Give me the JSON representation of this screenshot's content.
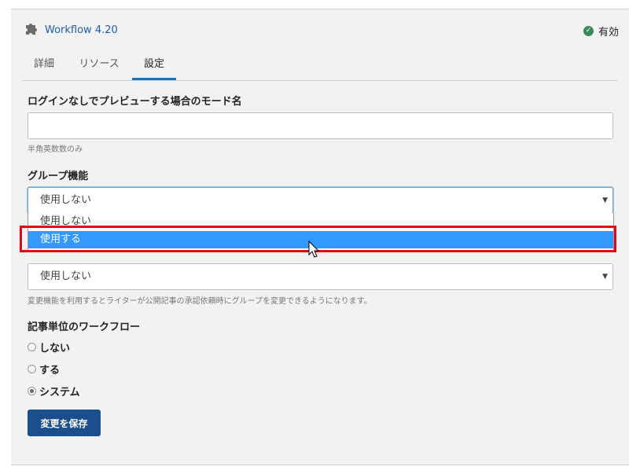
{
  "plugin": {
    "name": "Workflow 4.20",
    "icon": "puzzle-icon"
  },
  "status": {
    "label": "有効",
    "icon": "check-circle-icon",
    "color": "#3a8a5c"
  },
  "tabs": [
    {
      "label": "詳細"
    },
    {
      "label": "リソース"
    },
    {
      "label": "設定"
    }
  ],
  "active_tab": "設定",
  "fields": {
    "preview_mode": {
      "label": "ログインなしでプレビューする場合のモード名",
      "value": "",
      "help": "半角英数数のみ"
    },
    "group": {
      "label": "グループ機能",
      "value": "使用しない",
      "options": [
        "使用しない",
        "使用する"
      ],
      "highlighted": "使用する"
    },
    "group_change": {
      "value": "使用しない",
      "help": "変更機能を利用するとライターが公開記事の承認依頼時にグループを変更できるようになります。"
    },
    "article_workflow": {
      "label": "記事単位のワークフロー",
      "options": [
        {
          "label": "しない",
          "checked": false
        },
        {
          "label": "する",
          "checked": false
        },
        {
          "label": "システム",
          "checked": true
        }
      ]
    }
  },
  "save_label": "変更を保存",
  "colors": {
    "accent": "#1a73b8",
    "save_button": "#1a4f8c",
    "highlight_option": "#3399ff",
    "annotation": "#e30613"
  }
}
